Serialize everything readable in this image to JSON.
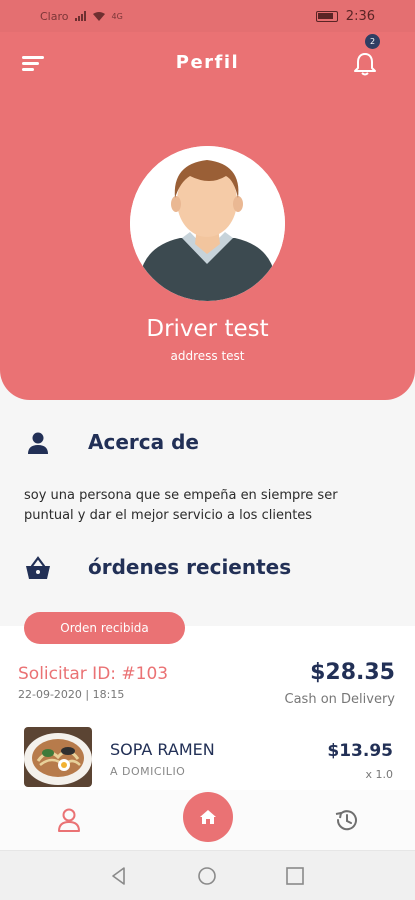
{
  "status_bar": {
    "carrier": "Claro",
    "network": "4G",
    "time": "2:36"
  },
  "header": {
    "title": "Perfil",
    "notification_count": "2"
  },
  "profile": {
    "name": "Driver test",
    "address": "address test"
  },
  "about": {
    "title": "Acerca de",
    "text": "soy una persona que se empeña en siempre ser puntual y dar el mejor servicio a los clientes"
  },
  "recent_orders": {
    "title": "órdenes recientes",
    "status_label": "Orden recibida"
  },
  "order": {
    "id_label": "Solicitar ID: #103",
    "date": "22-09-2020 | 18:15",
    "total": "$28.35",
    "payment_method": "Cash on Delivery",
    "item": {
      "name": "SOPA RAMEN",
      "type": "A DOMICILIO",
      "price": "$13.95",
      "qty": "x 1.0"
    }
  },
  "colors": {
    "accent": "#ea7274",
    "navy": "#223056"
  }
}
